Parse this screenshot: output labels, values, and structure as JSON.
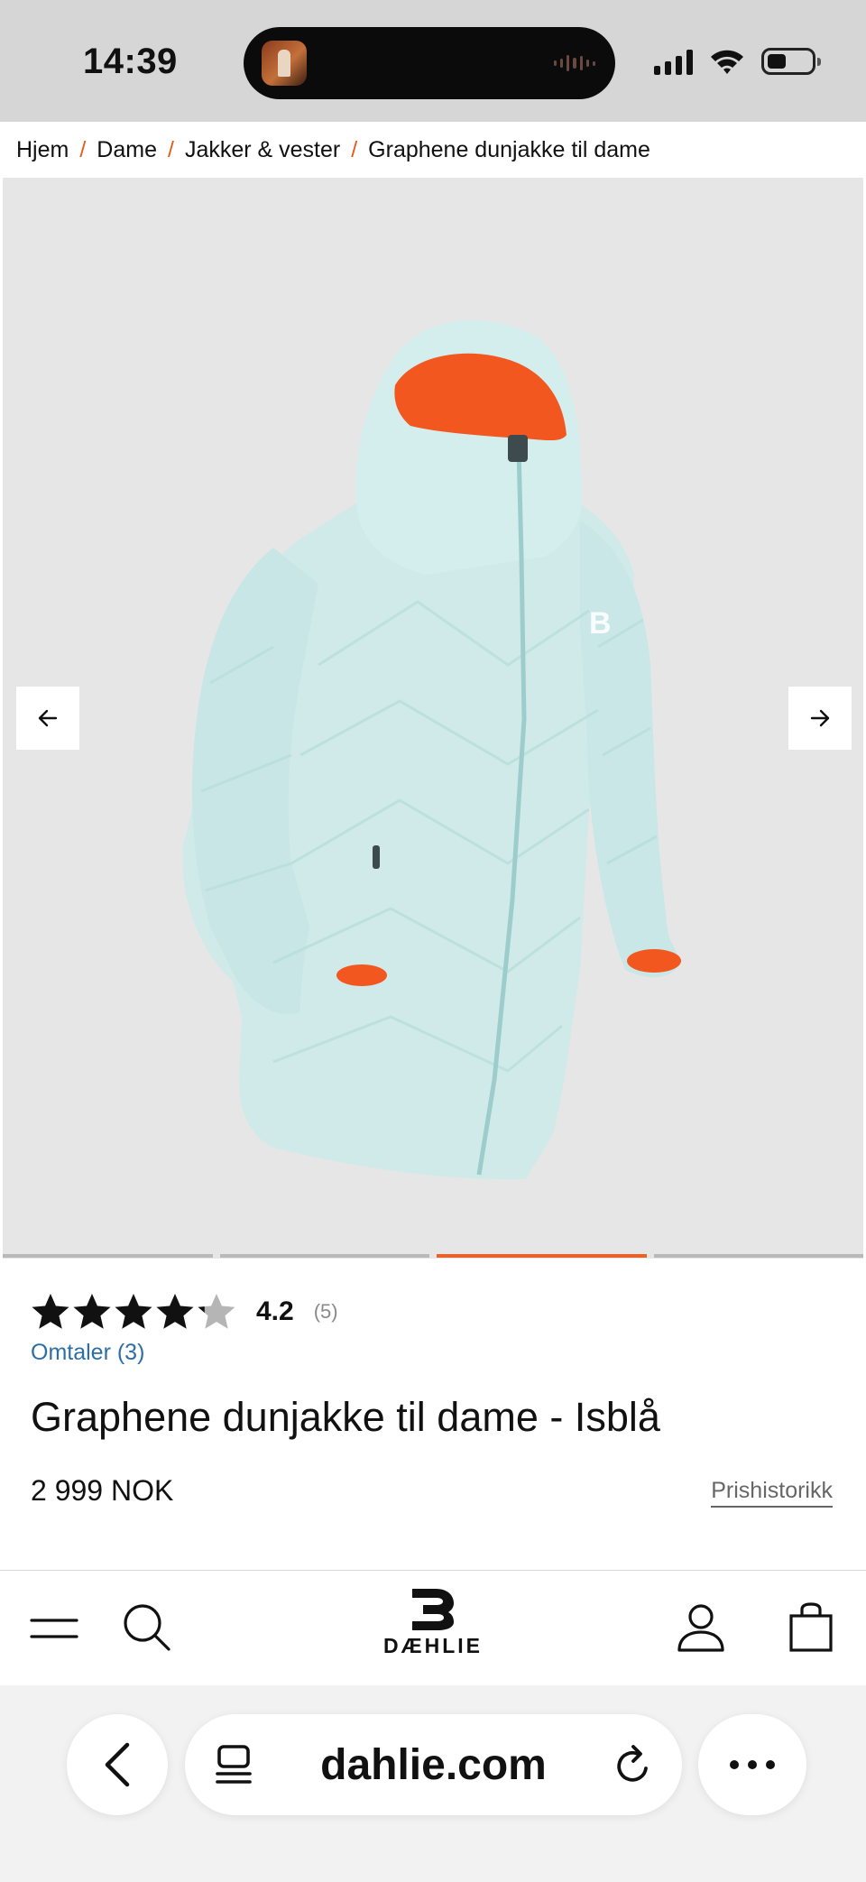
{
  "status_bar": {
    "time": "14:39"
  },
  "breadcrumb": {
    "items": [
      "Hjem",
      "Dame",
      "Jakker & vester",
      "Graphene dunjakke til dame"
    ],
    "separator": "/"
  },
  "gallery": {
    "slides": 4,
    "active_slide": 3,
    "accent_color": "#e8622a",
    "jacket_color": "#cfecea",
    "lining_color": "#f2571f"
  },
  "product": {
    "rating": {
      "stars": 4.2,
      "value": "4.2",
      "count": "(5)"
    },
    "reviews_link": "Omtaler (3)",
    "title": "Graphene dunjakke til dame - Isblå",
    "price": "2 999 NOK",
    "price_history": "Prishistorikk"
  },
  "site_nav": {
    "menu_icon": "menu-icon",
    "search_icon": "search-icon",
    "logo_text": "DÆHLIE",
    "account_icon": "user-icon",
    "cart_icon": "bag-icon"
  },
  "browser": {
    "url": "dahlie.com",
    "back_icon": "chevron-left-icon",
    "tabs_icon": "tabs-icon",
    "reload_icon": "reload-icon",
    "more_icon": "more-icon"
  }
}
